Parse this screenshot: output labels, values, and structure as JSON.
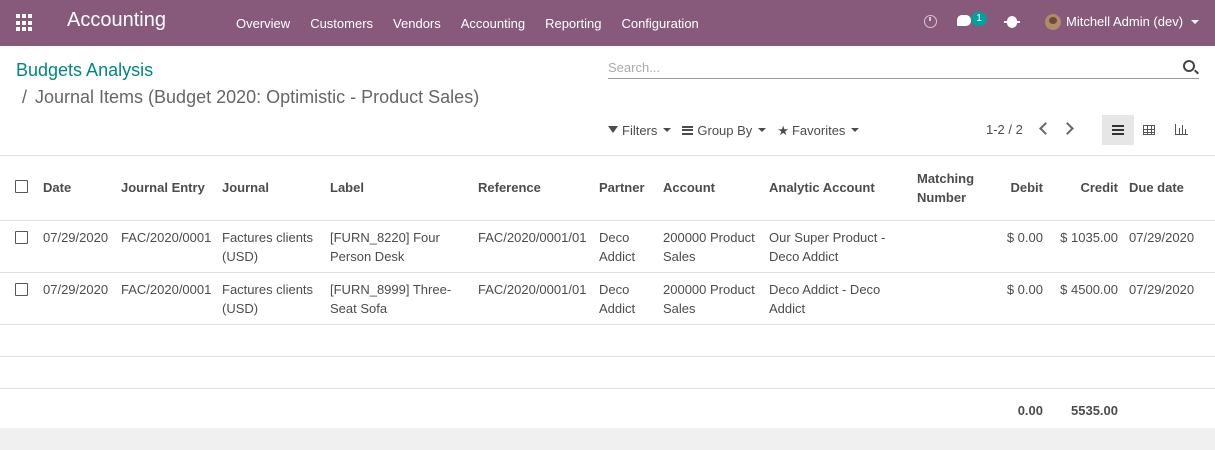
{
  "navbar": {
    "app_title": "Accounting",
    "menu": [
      "Overview",
      "Customers",
      "Vendors",
      "Accounting",
      "Reporting",
      "Configuration"
    ],
    "messages_count": "1",
    "user": "Mitchell Admin (dev)",
    "color": "#875a7b"
  },
  "breadcrumb": {
    "root": "Budgets Analysis",
    "separator": "/",
    "current": "Journal Items (Budget 2020: Optimistic - Product Sales)"
  },
  "search": {
    "placeholder": "Search..."
  },
  "filters": {
    "filters_label": "Filters",
    "group_by_label": "Group By",
    "favorites_label": "Favorites"
  },
  "pager": {
    "range": "1-2 / 2"
  },
  "table": {
    "columns": [
      "Date",
      "Journal Entry",
      "Journal",
      "Label",
      "Reference",
      "Partner",
      "Account",
      "Analytic Account",
      "Matching Number",
      "Debit",
      "Credit",
      "Due date"
    ],
    "rows": [
      {
        "date": "07/29/2020",
        "journal_entry": "FAC/2020/0001",
        "journal": "Factures clients (USD)",
        "label": "[FURN_8220] Four Person Desk",
        "reference": "FAC/2020/0001/01",
        "partner": "Deco Addict",
        "account": "200000 Product Sales",
        "analytic_account": "Our Super Product - Deco Addict",
        "matching_number": "",
        "debit": "$ 0.00",
        "credit": "$ 1035.00",
        "due_date": "07/29/2020"
      },
      {
        "date": "07/29/2020",
        "journal_entry": "FAC/2020/0001",
        "journal": "Factures clients (USD)",
        "label": "[FURN_8999] Three-Seat Sofa",
        "reference": "FAC/2020/0001/01",
        "partner": "Deco Addict",
        "account": "200000 Product Sales",
        "analytic_account": "Deco Addict - Deco Addict",
        "matching_number": "",
        "debit": "$ 0.00",
        "credit": "$ 4500.00",
        "due_date": "07/29/2020"
      }
    ],
    "totals": {
      "debit": "0.00",
      "credit": "5535.00"
    }
  }
}
